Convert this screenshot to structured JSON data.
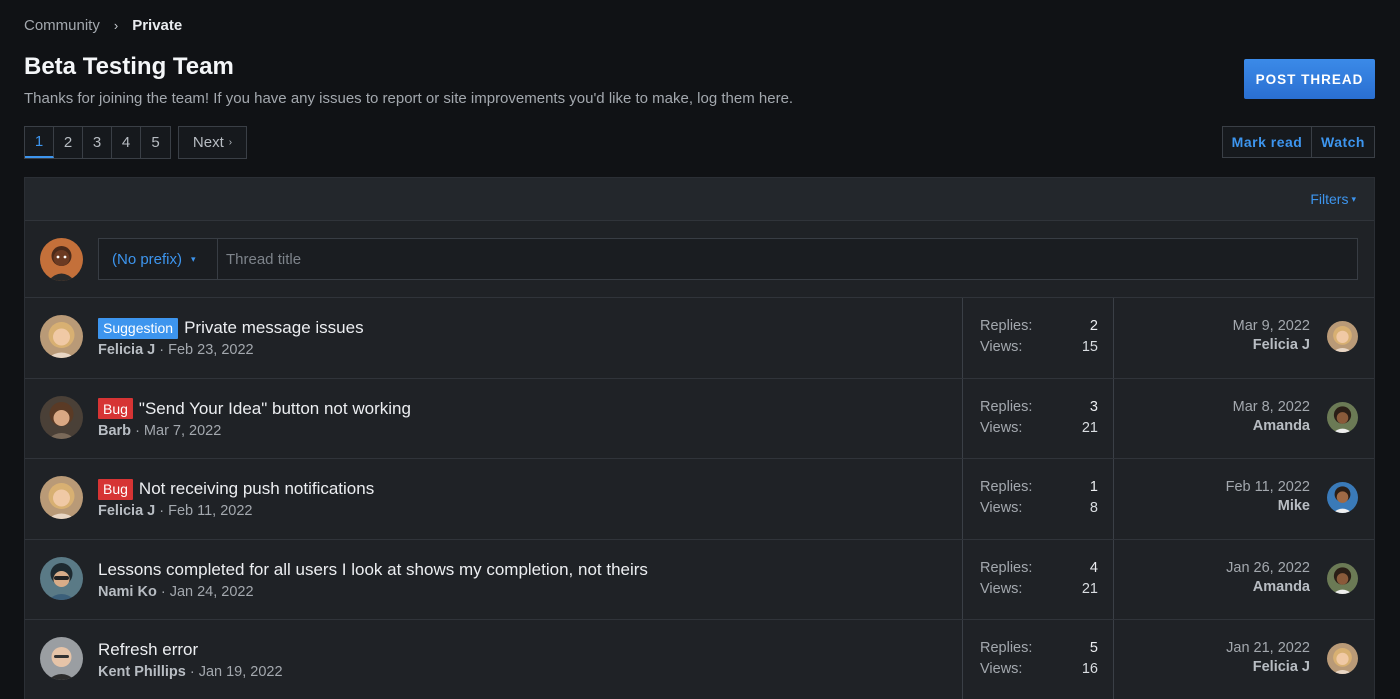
{
  "breadcrumb": {
    "parent": "Community",
    "separator": "›",
    "current": "Private"
  },
  "header": {
    "title": "Beta Testing Team",
    "description": "Thanks for joining the team! If you have any issues to report or site improvements you'd like to make, log them here.",
    "post_button": "POST THREAD"
  },
  "pager": {
    "pages": [
      "1",
      "2",
      "3",
      "4",
      "5"
    ],
    "active": "1",
    "next_label": "Next",
    "next_arrow": "›"
  },
  "actions": {
    "mark_read": "Mark read",
    "watch": "Watch"
  },
  "filters": {
    "label": "Filters",
    "caret": "▾"
  },
  "quick_thread": {
    "prefix": "(No prefix)",
    "prefix_caret": "▾",
    "placeholder": "Thread title"
  },
  "stat_labels": {
    "replies": "Replies:",
    "views": "Views:"
  },
  "threads": [
    {
      "label": "Suggestion",
      "label_type": "suggestion",
      "title": "Private message issues",
      "author": "Felicia J",
      "date": " · Feb 23, 2022",
      "replies": "2",
      "views": "15",
      "last_date": "Mar 9, 2022",
      "last_user": "Felicia J"
    },
    {
      "label": "Bug",
      "label_type": "bug",
      "title": "\"Send Your Idea\" button not working",
      "author": "Barb",
      "date": " · Mar 7, 2022",
      "replies": "3",
      "views": "21",
      "last_date": "Mar 8, 2022",
      "last_user": "Amanda"
    },
    {
      "label": "Bug",
      "label_type": "bug",
      "title": "Not receiving push notifications",
      "author": "Felicia J",
      "date": " · Feb 11, 2022",
      "replies": "1",
      "views": "8",
      "last_date": "Feb 11, 2022",
      "last_user": "Mike"
    },
    {
      "label": "",
      "label_type": "",
      "title": "Lessons completed for all users I look at shows my completion, not theirs",
      "author": "Nami Ko",
      "date": " · Jan 24, 2022",
      "replies": "4",
      "views": "21",
      "last_date": "Jan 26, 2022",
      "last_user": "Amanda"
    },
    {
      "label": "",
      "label_type": "",
      "title": "Refresh error",
      "author": "Kent Phillips",
      "date": " · Jan 19, 2022",
      "replies": "5",
      "views": "16",
      "last_date": "Jan 21, 2022",
      "last_user": "Felicia J"
    }
  ],
  "colors": {
    "accent": "#3d95ee",
    "bug": "#d63434",
    "background": "#101215",
    "panel": "#1f2226"
  }
}
